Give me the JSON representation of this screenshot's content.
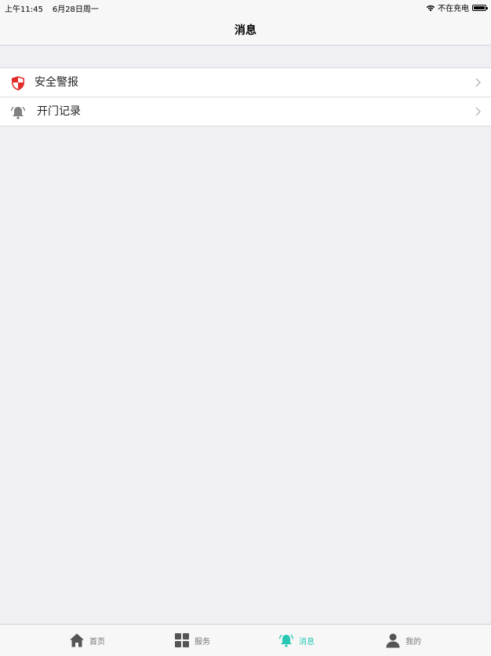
{
  "status_bar": {
    "time": "上午11:45",
    "date": "6月28日周一",
    "charging": "不在充电"
  },
  "nav": {
    "title": "消息"
  },
  "list": {
    "items": [
      {
        "label": "安全警报",
        "icon": "shield-icon"
      },
      {
        "label": "开门记录",
        "icon": "bell-icon"
      }
    ]
  },
  "tab_bar": {
    "active_color": "#27c7b4",
    "inactive_color": "#555555",
    "tabs": [
      {
        "label": "首页",
        "icon": "home-icon",
        "active": false
      },
      {
        "label": "服务",
        "icon": "grid-icon",
        "active": false
      },
      {
        "label": "消息",
        "icon": "bell-icon",
        "active": true
      },
      {
        "label": "我的",
        "icon": "person-icon",
        "active": false
      }
    ]
  }
}
